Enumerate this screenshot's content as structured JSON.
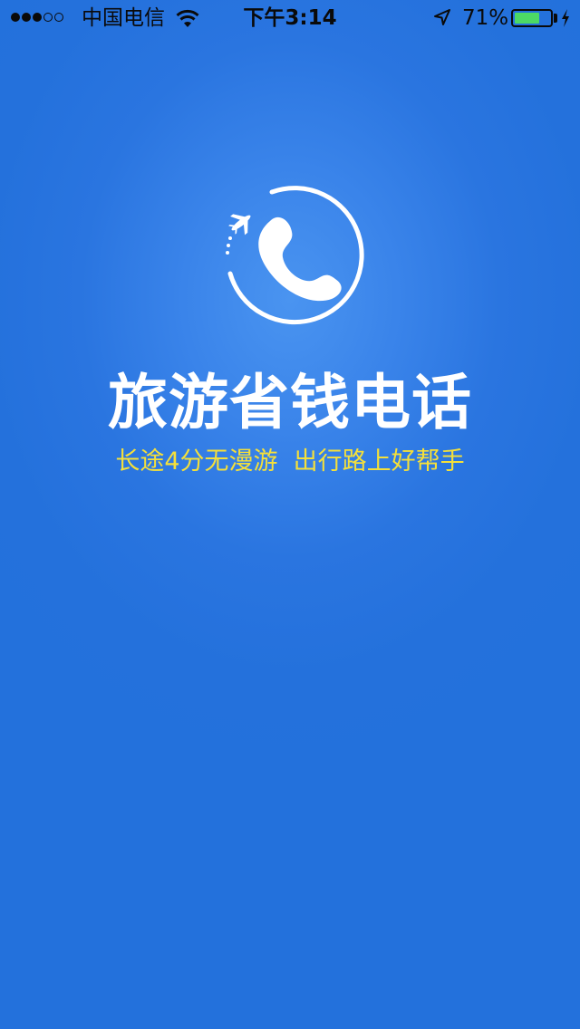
{
  "status_bar": {
    "carrier": "中国电信",
    "time": "下午3:14",
    "battery_percent": "71%",
    "battery_level": 0.71,
    "signal_strength": 3,
    "signal_max": 5,
    "icons": [
      "wifi-icon",
      "location-arrow-icon",
      "battery-icon",
      "charging-icon"
    ]
  },
  "splash": {
    "logo_icon": "phone-airplane-logo-icon",
    "title": "旅游省钱电话",
    "subtitle": "长途4分无漫游  出行路上好帮手"
  },
  "colors": {
    "background": "#2371dc",
    "title": "#ffffff",
    "subtitle": "#f5e03a",
    "battery_fill": "#4cd964"
  }
}
